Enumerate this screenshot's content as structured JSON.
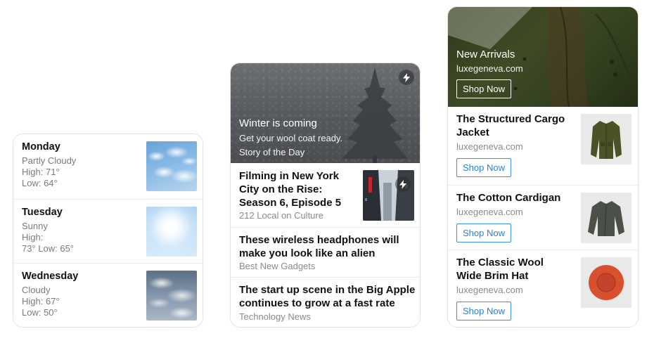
{
  "weather": {
    "days": [
      {
        "day": "Monday",
        "condition": "Partly Cloudy",
        "high": "High: 71°",
        "low": "Low: 64°",
        "image": "partly-cloudy-sky-photo"
      },
      {
        "day": "Tuesday",
        "condition": "Sunny",
        "high": "High:",
        "low": "73° Low: 65°",
        "image": "sunny-sky-photo"
      },
      {
        "day": "Wednesday",
        "condition": "Cloudy",
        "high": "High: 67°",
        "low": "Low: 50°",
        "image": "cloudy-sky-photo"
      }
    ]
  },
  "news": {
    "hero": {
      "title": "Winter is coming",
      "subtitle": "Get your wool coat ready.",
      "tag": "Story of the Day",
      "badge_icon": "lightning-bolt-icon"
    },
    "stories": [
      {
        "title_line1": "Filming in New York",
        "title_line2": "City on the Rise:",
        "title_line3": "Season 6, Episode 5",
        "source": "212 Local on Culture",
        "badge_icon": "lightning-bolt-icon"
      },
      {
        "title_line1": "These wireless headphones will",
        "title_line2": "make you look like an alien",
        "source": "Best New Gadgets"
      },
      {
        "title_line1": "The start up scene in the Big Apple",
        "title_line2": "continues to grow at a fast rate",
        "source": "Technology News"
      }
    ]
  },
  "shop": {
    "hero": {
      "title": "New Arrivals",
      "domain": "luxegeneva.com",
      "button": "Shop Now"
    },
    "products": [
      {
        "title_line1": "The Structured Cargo",
        "title_line2": "Jacket",
        "domain": "luxegeneva.com",
        "button": "Shop Now",
        "image": "olive-cargo-jacket"
      },
      {
        "title_line1": "The Cotton Cardigan",
        "title_line2": "",
        "domain": "luxegeneva.com",
        "button": "Shop Now",
        "image": "gray-cotton-cardigan"
      },
      {
        "title_line1": "The Classic Wool",
        "title_line2": "Wide Brim Hat",
        "domain": "luxegeneva.com",
        "button": "Shop Now",
        "image": "orange-wide-brim-hat"
      }
    ]
  },
  "colors": {
    "accent_blue": "#2f7fd1",
    "muted_text": "#8a8a8a",
    "divider": "#ececec"
  }
}
